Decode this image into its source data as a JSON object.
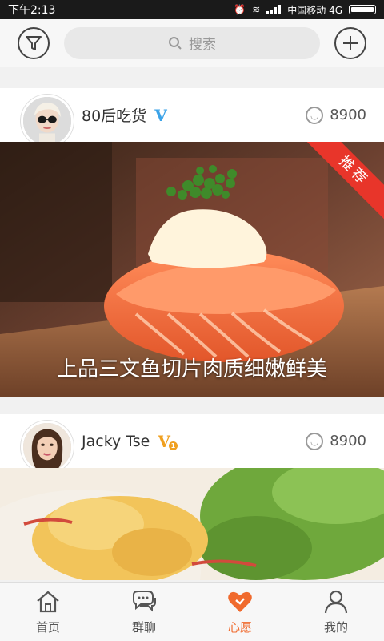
{
  "status_bar": {
    "time": "下午2:13",
    "carrier": "中国移动 4G"
  },
  "topbar": {
    "filter_icon": "filter-icon",
    "search_placeholder": "搜索",
    "add_icon": "plus-icon"
  },
  "feed": [
    {
      "username": "80后吃货",
      "badge": "V",
      "badge_color": "#3ba3e8",
      "likes": "8900",
      "caption": "上品三文鱼切片肉质细嫩鲜美",
      "ribbon": "推荐"
    },
    {
      "username": "Jacky Tse",
      "badge": "V",
      "badge_level": "1",
      "badge_color": "#f0a020",
      "likes": "8900"
    }
  ],
  "bottom_nav": [
    {
      "label": "首页",
      "icon": "home-icon"
    },
    {
      "label": "群聊",
      "icon": "chat-icon"
    },
    {
      "label": "心愿",
      "icon": "heart-icon",
      "active": true
    },
    {
      "label": "我的",
      "icon": "user-icon"
    }
  ],
  "colors": {
    "accent": "#f06a2d",
    "ribbon": "#e8352a"
  }
}
